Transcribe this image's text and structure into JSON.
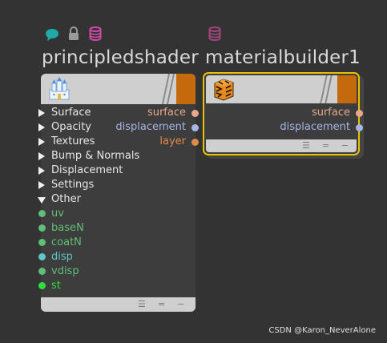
{
  "colors": {
    "background": "#333333",
    "node_body": "#3d3d3d",
    "header": "#cfcfcf",
    "flag_orange": "#c46a0d",
    "selected_outline": "#e8c200",
    "surface_port": "#e7a98b",
    "displacement_port": "#a8b4e6",
    "layer_port": "#e08a4c",
    "green_input": "#5fbf78",
    "cyan_input": "#5ec7c7",
    "bright_green_input": "#2fe03a"
  },
  "icons": {
    "comment": "speech-bubble-icon",
    "lock": "lock-icon",
    "database_left": "database-icon",
    "database_right": "database-icon"
  },
  "principled": {
    "title": "principledshader",
    "icon": "castle-icon",
    "outputs": [
      {
        "label": "surface",
        "color": "#e7a98b"
      },
      {
        "label": "displacement",
        "color": "#a8b4e6"
      },
      {
        "label": "layer",
        "color": "#e08a4c"
      }
    ],
    "folders": [
      {
        "label": "Surface",
        "expanded": false
      },
      {
        "label": "Opacity",
        "expanded": false
      },
      {
        "label": "Textures",
        "expanded": false
      },
      {
        "label": "Bump & Normals",
        "expanded": false
      },
      {
        "label": "Displacement",
        "expanded": false
      },
      {
        "label": "Settings",
        "expanded": false
      },
      {
        "label": "Other",
        "expanded": true
      }
    ],
    "inputs": [
      {
        "label": "uv",
        "color": "#5fbf78"
      },
      {
        "label": "baseN",
        "color": "#5fbf78"
      },
      {
        "label": "coatN",
        "color": "#5fbf78"
      },
      {
        "label": "disp",
        "color": "#5ec7c7"
      },
      {
        "label": "vdisp",
        "color": "#5fbf78"
      },
      {
        "label": "st",
        "color": "#2fe03a"
      }
    ]
  },
  "material": {
    "title": "materialbuilder1",
    "icon": "tiger-texture-icon",
    "outputs": [
      {
        "label": "surface",
        "color": "#e7a98b"
      },
      {
        "label": "displacement",
        "color": "#a8b4e6"
      }
    ]
  },
  "footer_glyphs": [
    "☰",
    "=",
    "−"
  ],
  "watermark": "CSDN @Karon_NeverAlone"
}
